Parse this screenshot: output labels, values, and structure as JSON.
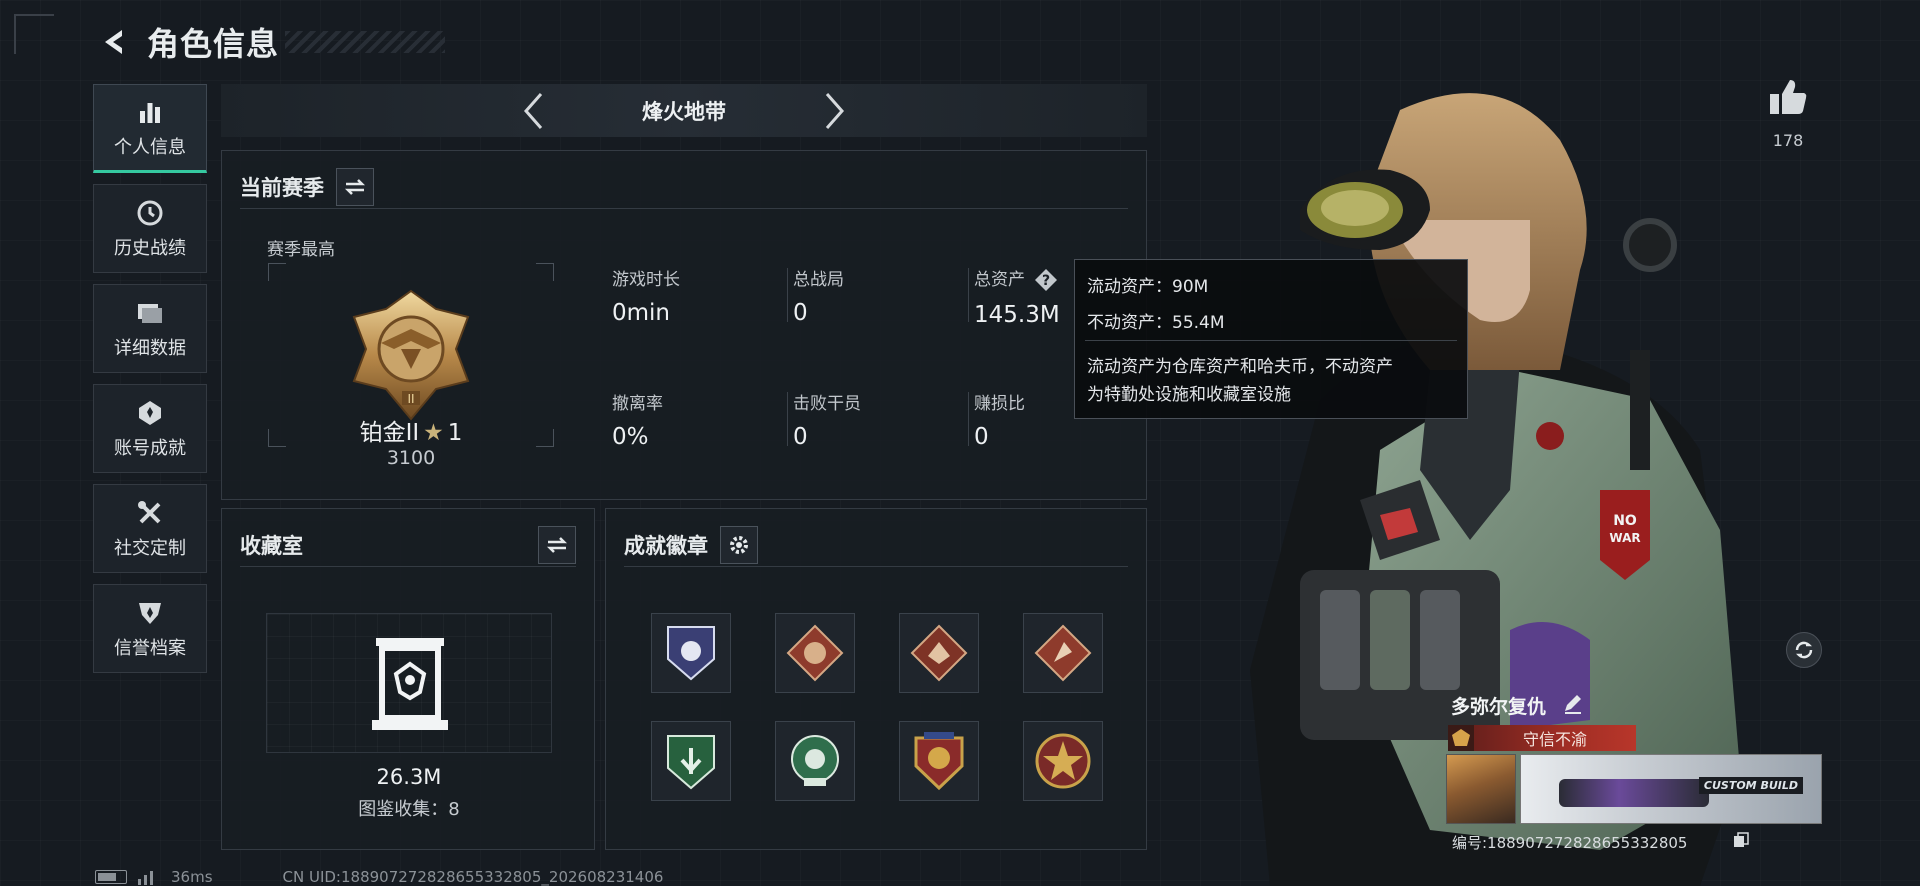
{
  "header": {
    "title": "角色信息"
  },
  "sidebar": {
    "items": [
      {
        "label": "个人信息",
        "icon": "bar-chart-icon",
        "active": true
      },
      {
        "label": "历史战绩",
        "icon": "clock-icon",
        "active": false
      },
      {
        "label": "详细数据",
        "icon": "folder-icon",
        "active": false
      },
      {
        "label": "账号成就",
        "icon": "achievement-icon",
        "active": false
      },
      {
        "label": "社交定制",
        "icon": "tools-icon",
        "active": false
      },
      {
        "label": "信誉档案",
        "icon": "shield-icon",
        "active": false
      }
    ]
  },
  "mode_bar": {
    "name": "烽火地带"
  },
  "season": {
    "title": "当前赛季",
    "subtitle": "赛季最高",
    "rank_name": "铂金II",
    "rank_star": "★",
    "rank_stars": "1",
    "rank_score": "3100",
    "stats": [
      {
        "label": "游戏时长",
        "value": "0min"
      },
      {
        "label": "总战局",
        "value": "0"
      },
      {
        "label": "总资产",
        "value": "145.3M"
      },
      {
        "label": "撤离率",
        "value": "0%"
      },
      {
        "label": "击败干员",
        "value": "0"
      },
      {
        "label": "赚损比",
        "value": "0"
      }
    ]
  },
  "tooltip": {
    "liquid": "流动资产：90M",
    "fixed": "不动资产：55.4M",
    "desc_1": "流动资产为仓库资产和哈夫币，不动资产",
    "desc_2": "为特勤处设施和收藏室设施"
  },
  "collection": {
    "title": "收藏室",
    "value": "26.3M",
    "count": "图鉴收集：8"
  },
  "achievements": {
    "title": "成就徽章",
    "badges": [
      "badge-1",
      "badge-2",
      "badge-3",
      "badge-4",
      "badge-5",
      "badge-6",
      "badge-7",
      "badge-8"
    ]
  },
  "profile": {
    "likes": "178",
    "name": "多弥尔复仇",
    "title": "守信不渝",
    "id": "编号:188907272828655332805"
  },
  "footer": {
    "ping": "36ms",
    "uid": "CN UID:188907272828655332805_202608231406"
  },
  "colors": {
    "accent": "#35c9a0",
    "title_plate": "#9e2d24"
  }
}
